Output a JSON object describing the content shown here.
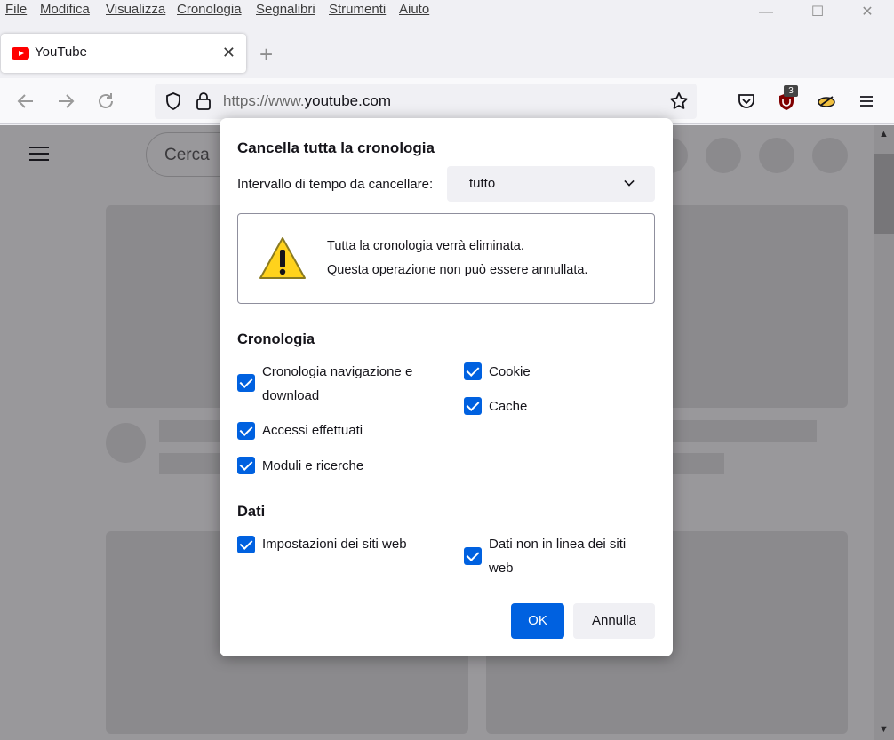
{
  "menubar": {
    "items": [
      "File",
      "Modifica",
      "Visualizza",
      "Cronologia",
      "Segnalibri",
      "Strumenti",
      "Aiuto"
    ]
  },
  "window_controls": {
    "minimize": "—",
    "maximize": "☐",
    "close": "✕"
  },
  "tab": {
    "title": "YouTube",
    "close": "✕",
    "new_tab": "+"
  },
  "urlbar": {
    "prefix": "https://www.",
    "domain": "youtube.com",
    "suffix": ""
  },
  "extensions": {
    "ublock_badge": "3"
  },
  "page": {
    "search_placeholder": "Cerca"
  },
  "dialog": {
    "title": "Cancella tutta la cronologia",
    "range_label": "Intervallo di tempo da cancellare:",
    "range_value": "tutto",
    "warning_line1": "Tutta la cronologia verrà eliminata.",
    "warning_line2": "Questa operazione non può essere annullata.",
    "history_section": "Cronologia",
    "history_items": [
      {
        "label_line1": "Cronologia navigazione e",
        "label_line2": "download",
        "checked": true
      },
      {
        "label": "Accessi effettuati",
        "checked": true
      },
      {
        "label": "Moduli e ricerche",
        "checked": true
      },
      {
        "label": "Cookie",
        "checked": true
      },
      {
        "label": "Cache",
        "checked": true
      }
    ],
    "data_section": "Dati",
    "data_items": [
      {
        "label": "Impostazioni dei siti web",
        "checked": true
      },
      {
        "label_line1": "Dati non in linea dei siti",
        "label_line2": "web",
        "checked": true
      }
    ],
    "ok_label": "OK",
    "cancel_label": "Annulla"
  },
  "colors": {
    "accent": "#0061e0",
    "warning": "#ffd21c"
  }
}
